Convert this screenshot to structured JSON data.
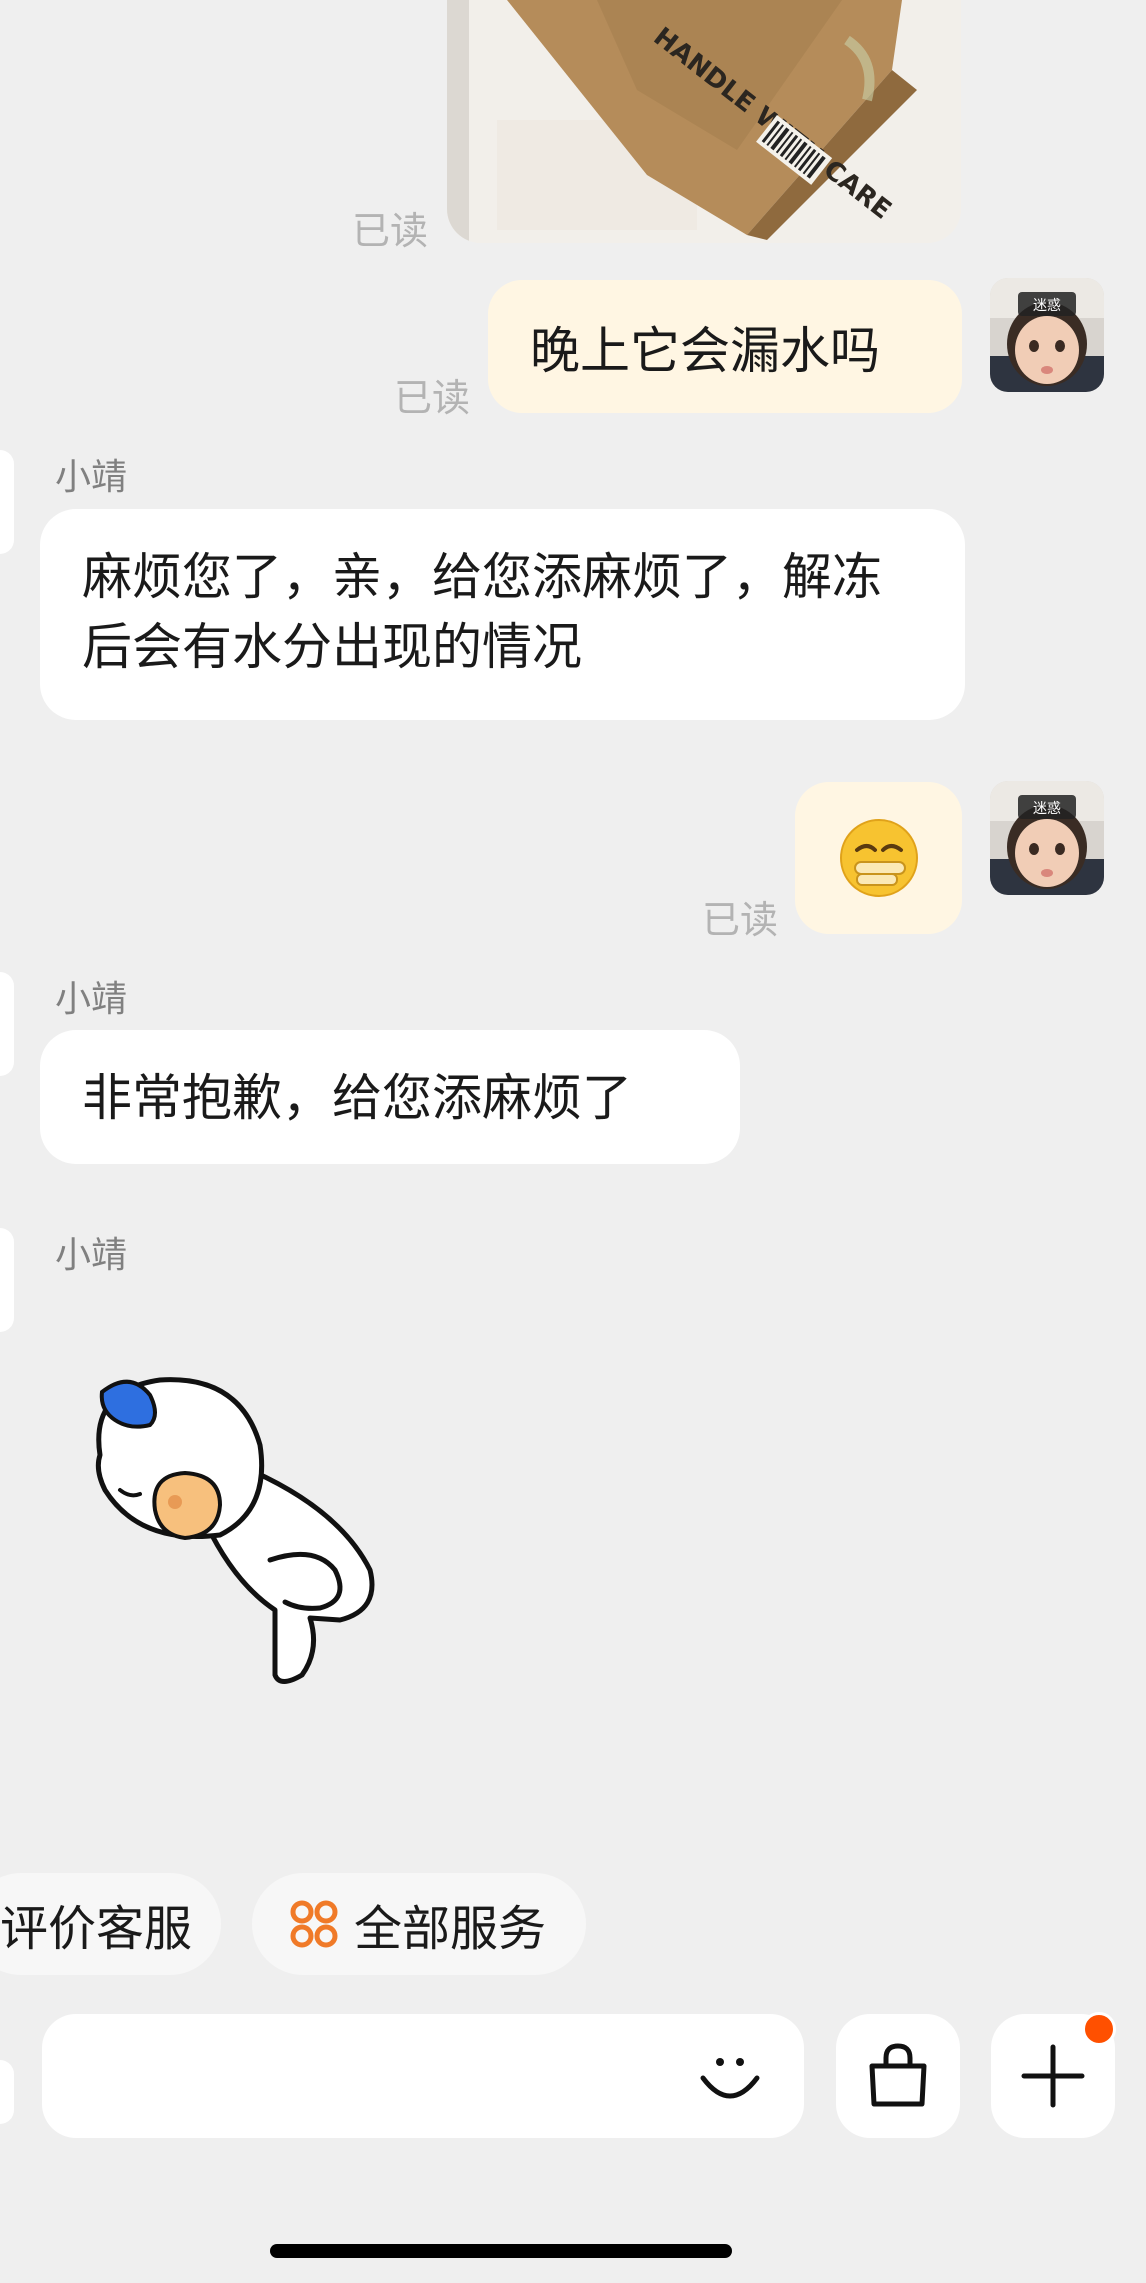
{
  "messages": {
    "top_image": {
      "status": "已读",
      "box_text": "HANDLE WITH CARE"
    },
    "out1": {
      "text": "晚上它会漏水吗",
      "status": "已读",
      "avatar_badge": "迷惑"
    },
    "in1": {
      "sender": "小靖",
      "text": "麻烦您了，亲，给您添麻烦了，解冻后会有水分出现的情况"
    },
    "out2": {
      "emoji": "😫",
      "status": "已读",
      "avatar_badge": "迷惑"
    },
    "in2": {
      "sender": "小靖",
      "text": "非常抱歉，给您添麻烦了"
    },
    "in3": {
      "sender": "小靖",
      "sticker": "bowing-duck-sticker"
    }
  },
  "quick_actions": [
    {
      "label": "评价客服"
    },
    {
      "label": "全部服务",
      "icon": "grid-flower-icon"
    }
  ],
  "input_bar": {
    "placeholder": "",
    "emoji_icon": "smiley-icon",
    "bag_icon": "shopping-bag-icon",
    "plus_icon": "plus-icon",
    "plus_badge_color": "#ff5000"
  },
  "colors": {
    "background": "#efefef",
    "outgoing_bubble": "#fff6e3",
    "incoming_bubble": "#ffffff",
    "accent": "#ff5000",
    "service_icon": "#f07a28"
  }
}
